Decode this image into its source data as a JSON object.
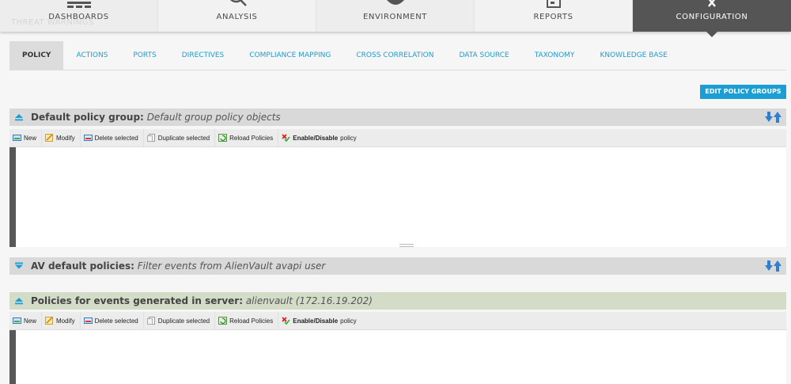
{
  "top_nav": {
    "ghost_text": "THREAT WARNINGS",
    "items": [
      {
        "label": "DASHBOARDS",
        "icon": "dashboard-icon"
      },
      {
        "label": "ANALYSIS",
        "icon": "search-icon"
      },
      {
        "label": "ENVIRONMENT",
        "icon": "eye-icon"
      },
      {
        "label": "REPORTS",
        "icon": "report-icon"
      },
      {
        "label": "CONFIGURATION",
        "icon": "close-icon",
        "active": true
      }
    ]
  },
  "sub_nav": {
    "tabs": [
      {
        "label": "POLICY",
        "active": true
      },
      {
        "label": "ACTIONS"
      },
      {
        "label": "PORTS"
      },
      {
        "label": "DIRECTIVES"
      },
      {
        "label": "COMPLIANCE MAPPING"
      },
      {
        "label": "CROSS CORRELATION"
      },
      {
        "label": "DATA SOURCE"
      },
      {
        "label": "TAXONOMY"
      },
      {
        "label": "KNOWLEDGE BASE"
      }
    ]
  },
  "edit_policy_groups_label": "EDIT POLICY GROUPS",
  "groups": [
    {
      "title": "Default policy group:",
      "subtitle": "Default group policy objects",
      "expanded": true,
      "toolbar": {
        "new": "New",
        "modify": "Modify",
        "delete": "Delete selected",
        "duplicate": "Duplicate selected",
        "reload": "Reload Policies",
        "enable_bold": "Enable/Disable",
        "enable_rest": "policy"
      }
    },
    {
      "title": "AV default policies:",
      "subtitle": "Filter events from AlienVault avapi user",
      "expanded": false
    },
    {
      "title": "Policies for events generated in server:",
      "subtitle": "alienvault (172.16.19.202)",
      "expanded": true,
      "toolbar": {
        "new": "New",
        "modify": "Modify",
        "delete": "Delete selected",
        "duplicate": "Duplicate selected",
        "reload": "Reload Policies",
        "enable_bold": "Enable/Disable",
        "enable_rest": "policy"
      }
    }
  ],
  "colors": {
    "accent": "#1b9ed3",
    "nav_active": "#555555",
    "group_header": "#d9d9d9",
    "server_group_header": "#d3dcc7"
  }
}
